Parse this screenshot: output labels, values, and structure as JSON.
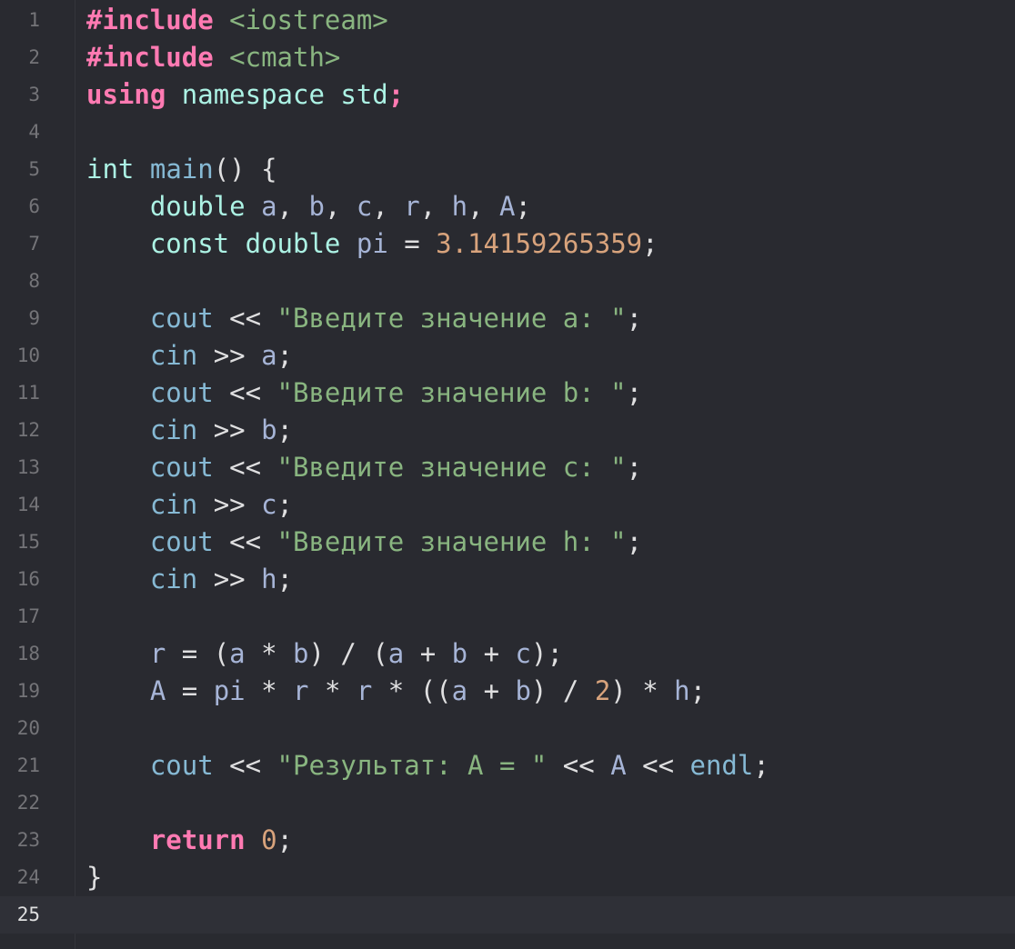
{
  "editor": {
    "current_line": 25,
    "lines": [
      {
        "n": "1",
        "tokens": [
          [
            "ppkw",
            "#include"
          ],
          [
            "plain",
            " "
          ],
          [
            "inc",
            "<iostream>"
          ]
        ]
      },
      {
        "n": "2",
        "tokens": [
          [
            "ppkw",
            "#include"
          ],
          [
            "plain",
            " "
          ],
          [
            "inc",
            "<cmath>"
          ]
        ]
      },
      {
        "n": "3",
        "tokens": [
          [
            "kw",
            "using"
          ],
          [
            "plain",
            " "
          ],
          [
            "typ",
            "namespace"
          ],
          [
            "plain",
            " "
          ],
          [
            "typ",
            "std"
          ],
          [
            "kw",
            ";"
          ]
        ]
      },
      {
        "n": "4",
        "tokens": []
      },
      {
        "n": "5",
        "tokens": [
          [
            "typ",
            "int"
          ],
          [
            "plain",
            " "
          ],
          [
            "fn",
            "main"
          ],
          [
            "pun",
            "() {"
          ]
        ]
      },
      {
        "n": "6",
        "tokens": [
          [
            "plain",
            "    "
          ],
          [
            "typ",
            "double"
          ],
          [
            "plain",
            " "
          ],
          [
            "var",
            "a"
          ],
          [
            "pun",
            ", "
          ],
          [
            "var",
            "b"
          ],
          [
            "pun",
            ", "
          ],
          [
            "var",
            "c"
          ],
          [
            "pun",
            ", "
          ],
          [
            "var",
            "r"
          ],
          [
            "pun",
            ", "
          ],
          [
            "var",
            "h"
          ],
          [
            "pun",
            ", "
          ],
          [
            "var",
            "A"
          ],
          [
            "pun",
            ";"
          ]
        ]
      },
      {
        "n": "7",
        "tokens": [
          [
            "plain",
            "    "
          ],
          [
            "typ",
            "const"
          ],
          [
            "plain",
            " "
          ],
          [
            "typ",
            "double"
          ],
          [
            "plain",
            " "
          ],
          [
            "var",
            "pi"
          ],
          [
            "pun",
            " = "
          ],
          [
            "num2",
            "3.14159265359"
          ],
          [
            "pun",
            ";"
          ]
        ]
      },
      {
        "n": "8",
        "tokens": []
      },
      {
        "n": "9",
        "tokens": [
          [
            "plain",
            "    "
          ],
          [
            "id",
            "cout"
          ],
          [
            "pun",
            " << "
          ],
          [
            "str",
            "\"Введите значение a: \""
          ],
          [
            "pun",
            ";"
          ]
        ]
      },
      {
        "n": "10",
        "tokens": [
          [
            "plain",
            "    "
          ],
          [
            "id",
            "cin"
          ],
          [
            "pun",
            " >> "
          ],
          [
            "var",
            "a"
          ],
          [
            "pun",
            ";"
          ]
        ]
      },
      {
        "n": "11",
        "tokens": [
          [
            "plain",
            "    "
          ],
          [
            "id",
            "cout"
          ],
          [
            "pun",
            " << "
          ],
          [
            "str",
            "\"Введите значение b: \""
          ],
          [
            "pun",
            ";"
          ]
        ]
      },
      {
        "n": "12",
        "tokens": [
          [
            "plain",
            "    "
          ],
          [
            "id",
            "cin"
          ],
          [
            "pun",
            " >> "
          ],
          [
            "var",
            "b"
          ],
          [
            "pun",
            ";"
          ]
        ]
      },
      {
        "n": "13",
        "tokens": [
          [
            "plain",
            "    "
          ],
          [
            "id",
            "cout"
          ],
          [
            "pun",
            " << "
          ],
          [
            "str",
            "\"Введите значение c: \""
          ],
          [
            "pun",
            ";"
          ]
        ]
      },
      {
        "n": "14",
        "tokens": [
          [
            "plain",
            "    "
          ],
          [
            "id",
            "cin"
          ],
          [
            "pun",
            " >> "
          ],
          [
            "var",
            "c"
          ],
          [
            "pun",
            ";"
          ]
        ]
      },
      {
        "n": "15",
        "tokens": [
          [
            "plain",
            "    "
          ],
          [
            "id",
            "cout"
          ],
          [
            "pun",
            " << "
          ],
          [
            "str",
            "\"Введите значение h: \""
          ],
          [
            "pun",
            ";"
          ]
        ]
      },
      {
        "n": "16",
        "tokens": [
          [
            "plain",
            "    "
          ],
          [
            "id",
            "cin"
          ],
          [
            "pun",
            " >> "
          ],
          [
            "var",
            "h"
          ],
          [
            "pun",
            ";"
          ]
        ]
      },
      {
        "n": "17",
        "tokens": []
      },
      {
        "n": "18",
        "tokens": [
          [
            "plain",
            "    "
          ],
          [
            "var",
            "r"
          ],
          [
            "pun",
            " = ("
          ],
          [
            "var",
            "a"
          ],
          [
            "pun",
            " * "
          ],
          [
            "var",
            "b"
          ],
          [
            "pun",
            ") / ("
          ],
          [
            "var",
            "a"
          ],
          [
            "pun",
            " + "
          ],
          [
            "var",
            "b"
          ],
          [
            "pun",
            " + "
          ],
          [
            "var",
            "c"
          ],
          [
            "pun",
            ");"
          ]
        ]
      },
      {
        "n": "19",
        "tokens": [
          [
            "plain",
            "    "
          ],
          [
            "var",
            "A"
          ],
          [
            "pun",
            " = "
          ],
          [
            "var",
            "pi"
          ],
          [
            "pun",
            " * "
          ],
          [
            "var",
            "r"
          ],
          [
            "pun",
            " * "
          ],
          [
            "var",
            "r"
          ],
          [
            "pun",
            " * (("
          ],
          [
            "var",
            "a"
          ],
          [
            "pun",
            " + "
          ],
          [
            "var",
            "b"
          ],
          [
            "pun",
            ") / "
          ],
          [
            "num2",
            "2"
          ],
          [
            "pun",
            ") * "
          ],
          [
            "var",
            "h"
          ],
          [
            "pun",
            ";"
          ]
        ]
      },
      {
        "n": "20",
        "tokens": []
      },
      {
        "n": "21",
        "tokens": [
          [
            "plain",
            "    "
          ],
          [
            "id",
            "cout"
          ],
          [
            "pun",
            " << "
          ],
          [
            "str",
            "\"Результат: A = \""
          ],
          [
            "pun",
            " << "
          ],
          [
            "var",
            "A"
          ],
          [
            "pun",
            " << "
          ],
          [
            "id",
            "endl"
          ],
          [
            "pun",
            ";"
          ]
        ]
      },
      {
        "n": "22",
        "tokens": []
      },
      {
        "n": "23",
        "tokens": [
          [
            "plain",
            "    "
          ],
          [
            "kw",
            "return"
          ],
          [
            "plain",
            " "
          ],
          [
            "num2",
            "0"
          ],
          [
            "pun",
            ";"
          ]
        ]
      },
      {
        "n": "24",
        "tokens": [
          [
            "pun",
            "}"
          ]
        ]
      },
      {
        "n": "25",
        "tokens": []
      }
    ]
  },
  "colors": {
    "background": "#292a30",
    "current_line": "#2f3037",
    "keyword": "#ff7ab2",
    "string": "#89b580",
    "number": "#d8a37c",
    "type": "#acf2e4",
    "identifier": "#86b9d4",
    "line_number": "#747478"
  }
}
